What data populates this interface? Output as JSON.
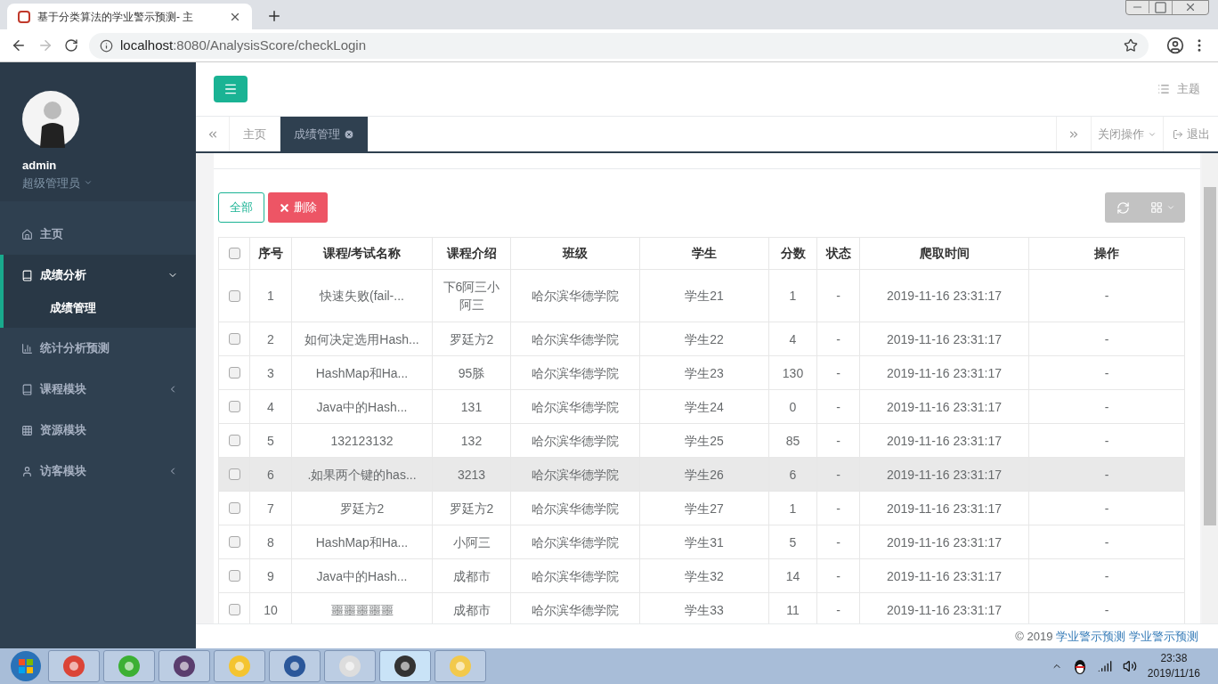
{
  "browser": {
    "tab_title": "基于分类算法的学业警示预测- 主",
    "url_host": "localhost",
    "url_path": ":8080/AnalysisScore/checkLogin"
  },
  "sidebar": {
    "user": {
      "name": "admin",
      "role": "超级管理员"
    },
    "items": [
      {
        "label": "主页"
      },
      {
        "label": "成绩分析",
        "expanded": true,
        "children": [
          {
            "label": "成绩管理",
            "selected": true
          }
        ]
      },
      {
        "label": "统计分析预测"
      },
      {
        "label": "课程模块",
        "expanded": false
      },
      {
        "label": "资源模块"
      },
      {
        "label": "访客模块",
        "expanded": false
      }
    ]
  },
  "header": {
    "theme": "主题"
  },
  "tabs": [
    {
      "label": "主页",
      "selected": false,
      "closable": false
    },
    {
      "label": "成绩管理",
      "selected": true,
      "closable": true
    }
  ],
  "tab_actions": {
    "close_ops": "关闭操作",
    "logout": "退出"
  },
  "toolbar": {
    "all": "全部",
    "delete": "删除"
  },
  "table": {
    "select_all_checked": false,
    "columns": [
      "序号",
      "课程/考试名称",
      "课程介绍",
      "班级",
      "学生",
      "分数",
      "状态",
      "爬取时间",
      "操作"
    ],
    "rows": [
      {
        "checked": false,
        "highlighted": false,
        "cells": [
          "1",
          "快速失败(fail-...",
          "下6阿三小阿三",
          "哈尔滨华德学院",
          "学生21",
          "1",
          "-",
          "2019-11-16 23:31:17",
          "-"
        ]
      },
      {
        "checked": false,
        "highlighted": false,
        "cells": [
          "2",
          "如何决定选用Hash...",
          "罗廷方2",
          "哈尔滨华德学院",
          "学生22",
          "4",
          "-",
          "2019-11-16 23:31:17",
          "-"
        ]
      },
      {
        "checked": false,
        "highlighted": false,
        "cells": [
          "3",
          "HashMap和Ha...",
          "95脎",
          "哈尔滨华德学院",
          "学生23",
          "130",
          "-",
          "2019-11-16 23:31:17",
          "-"
        ]
      },
      {
        "checked": false,
        "highlighted": false,
        "cells": [
          "4",
          "Java中的Hash...",
          "131",
          "哈尔滨华德学院",
          "学生24",
          "0",
          "-",
          "2019-11-16 23:31:17",
          "-"
        ]
      },
      {
        "checked": false,
        "highlighted": false,
        "cells": [
          "5",
          "132123132",
          "132",
          "哈尔滨华德学院",
          "学生25",
          "85",
          "-",
          "2019-11-16 23:31:17",
          "-"
        ]
      },
      {
        "checked": false,
        "highlighted": true,
        "cells": [
          "6",
          ".如果两个键的has...",
          "3213",
          "哈尔滨华德学院",
          "学生26",
          "6",
          "-",
          "2019-11-16 23:31:17",
          "-"
        ]
      },
      {
        "checked": false,
        "highlighted": false,
        "cells": [
          "7",
          "罗廷方2",
          "罗廷方2",
          "哈尔滨华德学院",
          "学生27",
          "1",
          "-",
          "2019-11-16 23:31:17",
          "-"
        ]
      },
      {
        "checked": false,
        "highlighted": false,
        "cells": [
          "8",
          "HashMap和Ha...",
          "小阿三",
          "哈尔滨华德学院",
          "学生31",
          "5",
          "-",
          "2019-11-16 23:31:17",
          "-"
        ]
      },
      {
        "checked": false,
        "highlighted": false,
        "cells": [
          "9",
          "Java中的Hash...",
          "成都市",
          "哈尔滨华德学院",
          "学生32",
          "14",
          "-",
          "2019-11-16 23:31:17",
          "-"
        ]
      },
      {
        "checked": false,
        "highlighted": false,
        "cells": [
          "10",
          "噩噩噩噩噩",
          "成都市",
          "哈尔滨华德学院",
          "学生33",
          "11",
          "-",
          "2019-11-16 23:31:17",
          "-"
        ]
      }
    ]
  },
  "footer": {
    "prefix": "© 2019",
    "link": "学业警示预测 学业警示预测"
  },
  "taskbar": {
    "time": "23:38",
    "date": "2019/11/16"
  }
}
